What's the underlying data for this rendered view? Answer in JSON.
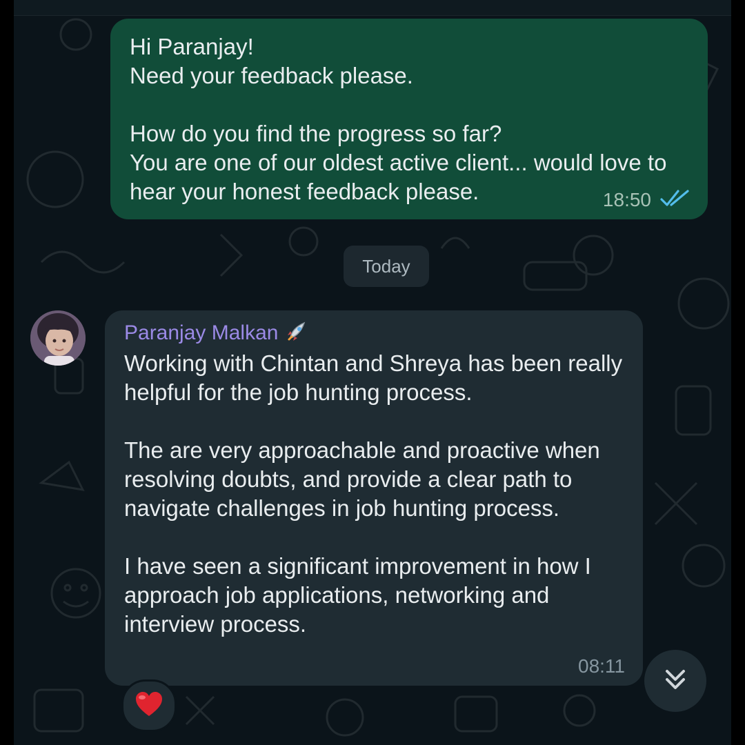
{
  "outgoing_message": {
    "text": "Hi Paranjay!\nNeed your feedback please.\n\nHow do you find the progress so far?\nYou are one of our oldest active client... would love to hear your honest feedback please.",
    "time": "18:50",
    "status_icon": "double-check-read-icon"
  },
  "date_separator": "Today",
  "incoming_message": {
    "sender_name": "Paranjay Malkan",
    "sender_emoji": "rocket-icon",
    "text": "Working with Chintan and Shreya has been really helpful for the job hunting process.\n\nThe are very approachable and proactive when resolving doubts, and provide a clear path to navigate challenges in job hunting process.\n\nI have seen a significant improvement in how I approach job applications, networking and interview process.",
    "time": "08:11",
    "reaction": "red-heart-icon"
  },
  "colors": {
    "background": "#0b141a",
    "outgoing_bubble": "#114d39",
    "incoming_bubble": "#1f2c33",
    "sender_name": "#9b8ae6",
    "read_ticks": "#53bdeb"
  }
}
